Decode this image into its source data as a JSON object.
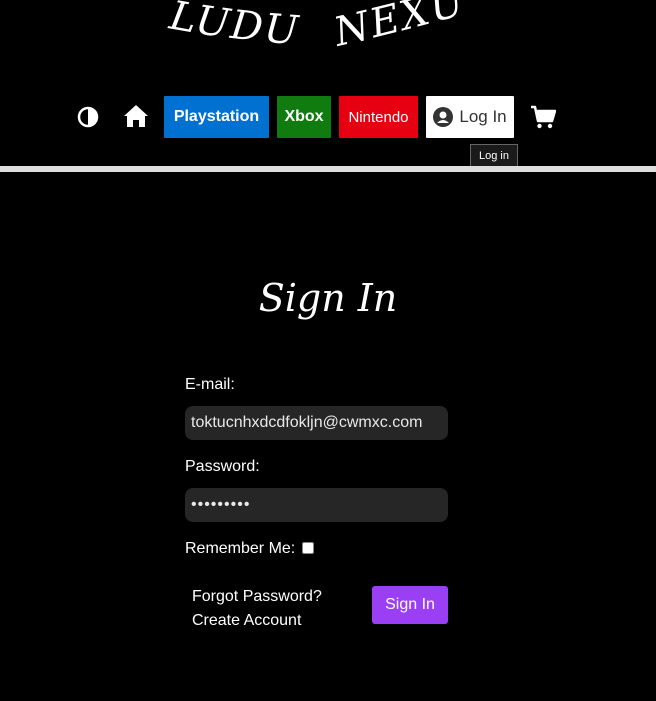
{
  "logo": {
    "word1": "LUDUS",
    "word2": "NEXUS"
  },
  "nav": {
    "contrast_icon": "contrast-icon",
    "home_icon": "home-icon",
    "playstation": "Playstation",
    "xbox": "Xbox",
    "nintendo": "Nintendo",
    "login": "Log In",
    "login_icon": "user-circle-icon",
    "cart_icon": "cart-icon",
    "tooltip": "Log in"
  },
  "colors": {
    "playstation": "#0070d1",
    "xbox": "#107c10",
    "nintendo": "#e60012",
    "signin": "#9b3ff5"
  },
  "form": {
    "title": "Sign In",
    "email_label": "E-mail:",
    "email_value": "toktucnhxdcdfokljn@cwmxc.com",
    "password_label": "Password:",
    "password_value": "•••••••••",
    "remember_label": "Remember Me:",
    "forgot": "Forgot Password?",
    "create": "Create Account",
    "submit": "Sign In"
  }
}
